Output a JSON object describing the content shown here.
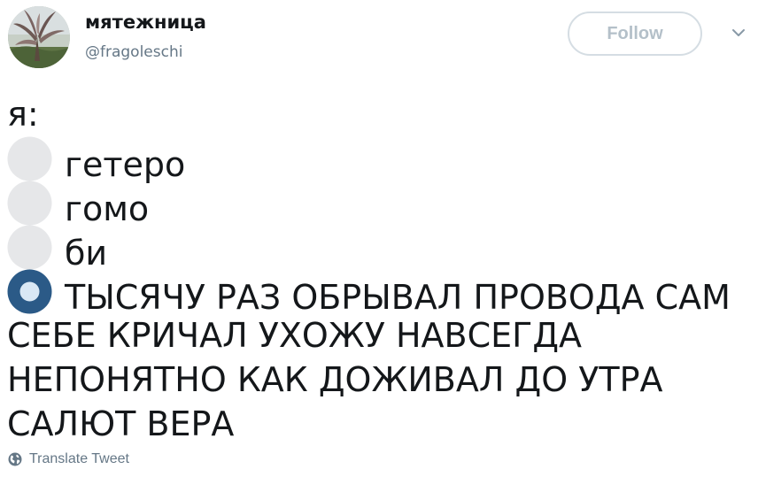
{
  "author": {
    "display_name": "мятежница",
    "username": "@fragoleschi"
  },
  "follow_button": {
    "label": "Follow"
  },
  "icons": {
    "menu": "chevron-down-icon",
    "translate": "globe-icon",
    "option_empty": "white-circle-icon",
    "option_selected": "radio-button-icon"
  },
  "tweet": {
    "intro": "я:",
    "options": [
      {
        "label": "гетеро",
        "selected": false
      },
      {
        "label": "гомо",
        "selected": false
      },
      {
        "label": "би",
        "selected": false
      },
      {
        "label": "ТЫСЯЧУ РАЗ ОБРЫВАЛ ПРОВОДА САМ",
        "selected": true
      }
    ],
    "continuation": [
      "СЕБЕ КРИЧАЛ УХОЖУ НАВСЕГДА",
      "НЕПОНЯТНО КАК ДОЖИВАЛ ДО УТРА",
      "САЛЮТ ВЕРА"
    ]
  },
  "translate": {
    "label": "Translate Tweet"
  },
  "colors": {
    "text": "#14171a",
    "secondary": "#657786",
    "follow_border": "#d5dde3",
    "follow_text": "#b4c0c9",
    "radio_outer": "#2b5a87",
    "radio_inner": "#d9e8f5",
    "empty_circle": "#e6e7e9"
  }
}
